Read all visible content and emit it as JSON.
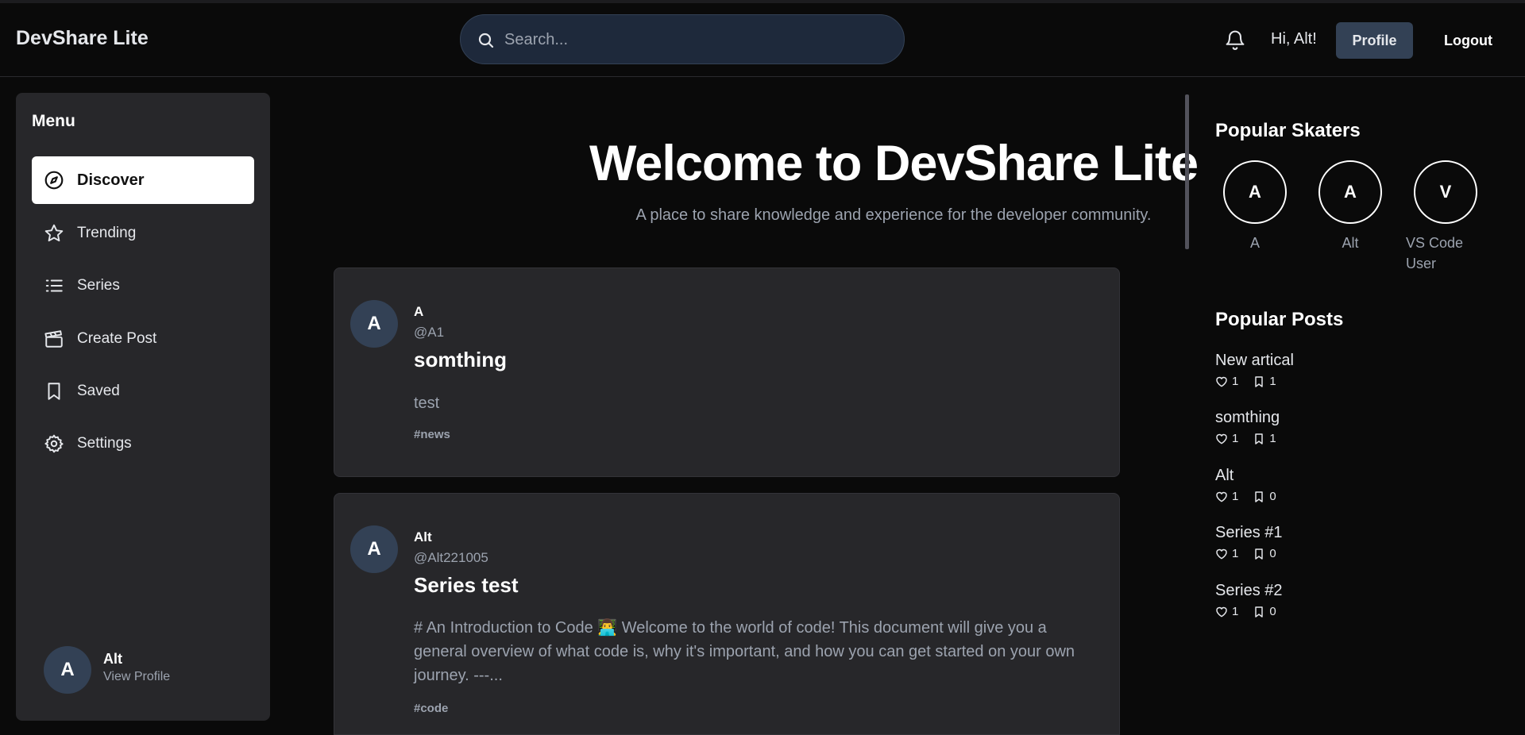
{
  "header": {
    "brand": "DevShare Lite",
    "search_placeholder": "Search...",
    "greeting": "Hi, Alt!",
    "profile_label": "Profile",
    "logout_label": "Logout"
  },
  "sidebar": {
    "title": "Menu",
    "items": [
      {
        "label": "Discover",
        "icon": "compass-icon",
        "active": true
      },
      {
        "label": "Trending",
        "icon": "star-icon"
      },
      {
        "label": "Series",
        "icon": "list-icon"
      },
      {
        "label": "Create Post",
        "icon": "clapperboard-icon"
      },
      {
        "label": "Saved",
        "icon": "bookmark-icon"
      },
      {
        "label": "Settings",
        "icon": "gear-icon"
      }
    ],
    "user": {
      "initial": "A",
      "name": "Alt",
      "link": "View Profile"
    }
  },
  "hero": {
    "title": "Welcome to DevShare Lite",
    "subtitle": "A place to share knowledge and experience for the developer community."
  },
  "posts": [
    {
      "initial": "A",
      "author": "A",
      "handle": "@A1",
      "title": "somthing",
      "excerpt": "test",
      "tag": "#news"
    },
    {
      "initial": "A",
      "author": "Alt",
      "handle": "@Alt221005",
      "title": "Series test",
      "excerpt": "# An Introduction to Code 👨‍💻 Welcome to the world of code! This document will give you a general overview of what code is, why it's important, and how you can get started on your own journey. ---...",
      "tag": "#code"
    }
  ],
  "popular_skaters": {
    "title": "Popular Skaters",
    "items": [
      {
        "initial": "A",
        "name": "A"
      },
      {
        "initial": "A",
        "name": "Alt"
      },
      {
        "initial": "V",
        "name": "VS Code User"
      }
    ]
  },
  "popular_posts": {
    "title": "Popular Posts",
    "items": [
      {
        "title": "New artical",
        "likes": "1",
        "saves": "1"
      },
      {
        "title": "somthing",
        "likes": "1",
        "saves": "1"
      },
      {
        "title": "Alt",
        "likes": "1",
        "saves": "0"
      },
      {
        "title": "Series #1",
        "likes": "1",
        "saves": "0"
      },
      {
        "title": "Series #2",
        "likes": "1",
        "saves": "0"
      }
    ]
  },
  "colors": {
    "background": "#0a0a0a",
    "panel": "#27272a",
    "avatar": "#334155",
    "muted": "#9ca3af"
  }
}
